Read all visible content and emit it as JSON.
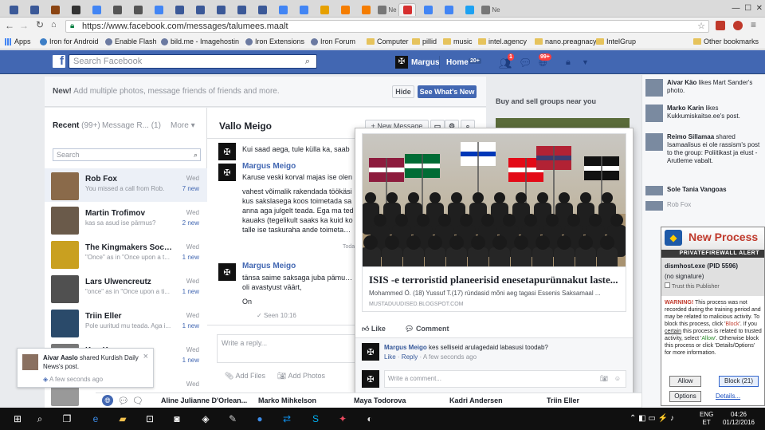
{
  "browser": {
    "tabs": [
      {
        "icon": "facebook-icon",
        "color": "#3b5998",
        "label": ""
      },
      {
        "icon": "blogger-b-icon",
        "color": "#3b5998",
        "label": ""
      },
      {
        "icon": "paw-icon",
        "color": "#8b4513",
        "label": ""
      },
      {
        "icon": "x-icon",
        "color": "#333333",
        "label": ""
      },
      {
        "icon": "google-g-icon",
        "color": "#4285f4",
        "label": ""
      },
      {
        "icon": "circle-icon",
        "color": "#555555",
        "label": ""
      },
      {
        "icon": "circle-icon",
        "color": "#555555",
        "label": ""
      },
      {
        "icon": "google-g-icon",
        "color": "#4285f4",
        "label": ""
      },
      {
        "icon": "facebook-icon",
        "color": "#3b5998",
        "label": ""
      },
      {
        "icon": "facebook-icon",
        "color": "#3b5998",
        "label": ""
      },
      {
        "icon": "facebook-icon",
        "color": "#3b5998",
        "label": ""
      },
      {
        "icon": "facebook-icon",
        "color": "#3b5998",
        "label": ""
      },
      {
        "icon": "facebook-icon",
        "color": "#3b5998",
        "label": ""
      },
      {
        "icon": "google-g-icon",
        "color": "#4285f4",
        "label": ""
      },
      {
        "icon": "google-g-icon",
        "color": "#4285f4",
        "label": ""
      },
      {
        "icon": "w-icon",
        "color": "#e6a000",
        "label": ""
      },
      {
        "icon": "blogger-icon",
        "color": "#f57d00",
        "label": ""
      },
      {
        "icon": "blogger-icon",
        "color": "#f57d00",
        "label": ""
      },
      {
        "icon": "news-icon",
        "color": "#777777",
        "label": "Ne"
      },
      {
        "icon": "close-x-icon",
        "color": "#d62f2f",
        "label": ""
      },
      {
        "icon": "google-g-icon",
        "color": "#4285f4",
        "label": ""
      },
      {
        "icon": "google-g-icon",
        "color": "#4285f4",
        "label": ""
      },
      {
        "icon": "twitter-icon",
        "color": "#1da1f2",
        "label": ""
      },
      {
        "icon": "news-icon",
        "color": "#777777",
        "label": "Ne"
      }
    ],
    "url": "https://www.facebook.com/messages/talumees.maalt",
    "apps_label": "Apps",
    "bookmarks": [
      {
        "label": "Iron for Android",
        "icon": "android-icon"
      },
      {
        "label": "Enable Flash",
        "icon": "page-icon"
      },
      {
        "label": "bild.me - Imagehostin",
        "icon": "page-icon"
      },
      {
        "label": "Iron Extensions",
        "icon": "page-icon"
      },
      {
        "label": "Iron Forum",
        "icon": "iron-icon"
      },
      {
        "label": "Computer",
        "icon": "folder-icon"
      },
      {
        "label": "pillid",
        "icon": "folder-icon"
      },
      {
        "label": "music",
        "icon": "folder-icon"
      },
      {
        "label": "intel.agency",
        "icon": "folder-icon"
      },
      {
        "label": "nano.preagnacy",
        "icon": "folder-icon"
      },
      {
        "label": "IntelGrup",
        "icon": "folder-icon"
      }
    ],
    "other_bookmarks": "Other bookmarks"
  },
  "fb_header": {
    "search_placeholder": "Search Facebook",
    "user": "Margus",
    "home": "Home",
    "home_badge": "20+",
    "friend_badge": "1",
    "notif_badge": "99+"
  },
  "messages": {
    "new_banner": {
      "bold": "New!",
      "text": "Add multiple photos, message friends of friends and more.",
      "hide": "Hide",
      "see_whats_new": "See What's New"
    },
    "tabs": {
      "recent": "Recent",
      "recent_count": "(99+)",
      "requests": "Message R...",
      "requests_count": "(1)",
      "more": "More"
    },
    "search_placeholder": "Search",
    "conversations": [
      {
        "name": "Rob Fox",
        "snippet": "You missed a call from Rob.",
        "date": "Wed",
        "new": "7 new",
        "color": "#8a6a4a"
      },
      {
        "name": "Martin Trofimov",
        "snippet": "kas sa asud ise pärmus?",
        "date": "Wed",
        "new": "2 new",
        "color": "#6a5a4a"
      },
      {
        "name": "The Kingmakers Society",
        "snippet": "\"Once\" as in \"Once upon a t...",
        "date": "Wed",
        "new": "1 new",
        "color": "#c9a020"
      },
      {
        "name": "Lars Ulwencreutz",
        "snippet": "\"once\" as in \"Once upon a ti...",
        "date": "Wed",
        "new": "1 new",
        "color": "#505050"
      },
      {
        "name": "Triin Eller",
        "snippet": "Pole uuritud mu teada. Aga i...",
        "date": "Wed",
        "new": "1 new",
        "color": "#2a4a6a"
      },
      {
        "name": "Ken K...",
        "snippet": "",
        "date": "Wed",
        "new": "1 new",
        "color": "#777777"
      },
      {
        "name": "",
        "snippet": "",
        "date": "Wed",
        "new": "",
        "color": "#999999"
      }
    ],
    "conversation_title": "Vallo Meigo",
    "new_message": "+ New Message",
    "thread": {
      "first_line": "Kui saad aega, tule külla ka, saab",
      "m1_sender": "Margus Meigo",
      "m1_line1": "Karuse veski korval majas ise olen",
      "m1_p2": [
        "vahest võimalik rakendada töökäsi",
        "kus sakslasega koos toimetada sa",
        "anna aga julgelt teada. Ega ma ted",
        "kauaks (tegelikult saaks ka kuid ko",
        "talle ise taskuraha ande toimetamis"
      ],
      "today": "Today",
      "m2_sender": "Margus Meigo",
      "m2_lines": [
        "tänsa saime saksaga juba pämut ja",
        "oli avastyust väärt,"
      ],
      "m2_last": "On",
      "seen": "Seen 10:16"
    },
    "reply_placeholder": "Write a reply...",
    "add_files": "Add Files",
    "add_photos": "Add Photos"
  },
  "right": {
    "groups_header": "Buy and sell groups near you"
  },
  "ticker": [
    {
      "bold": "Aivar Käo",
      "text": " likes Mart Sander's photo."
    },
    {
      "bold": "Marko Karin",
      "text": " likes Kukkumiskaitse.ee's post."
    },
    {
      "bold": "Reimo Sillamaa",
      "text": " shared Isamaalisus ei ole rassism's post to the group: Poliitikast ja elust - Arutleme vabalt."
    },
    {
      "bold": "Sole Tania Vangoas",
      "text": ""
    },
    {
      "bold": "Rob Fox",
      "text": ""
    }
  ],
  "popup": {
    "headline": "ISIS -e terroristid planeerisid enesetapurünnakut laste...",
    "desc": "Mohammed Ö. (18) Yussuf T.(17) ründasid mõni aeg tagasi Essenis Saksamaal ...",
    "domain": "MUSTADUUDISED.BLOGSPOT.COM",
    "like": "Like",
    "comment": "Comment",
    "comment_author": "Margus Meigo",
    "comment_text": " kes selliseid arulagedaid labasusi toodab?",
    "comment_like": "Like",
    "comment_reply": "Reply",
    "comment_time": "A few seconds ago",
    "write_comment": "Write a comment...",
    "flags": [
      {
        "name": "qatar-flag",
        "colors": [
          "#8d1b3d",
          "#ffffff"
        ]
      },
      {
        "name": "saudi-flag",
        "colors": [
          "#006c35",
          "#ffffff"
        ]
      },
      {
        "name": "israel-flag",
        "colors": [
          "#ffffff",
          "#0038b8"
        ]
      },
      {
        "name": "turkey-flag",
        "colors": [
          "#e30a17",
          "#ffffff"
        ]
      },
      {
        "name": "usa-flag",
        "colors": [
          "#b22234",
          "#3c3b6e"
        ]
      },
      {
        "name": "black-flag",
        "colors": [
          "#111111",
          "#ffffff"
        ]
      }
    ]
  },
  "notification": {
    "bold": "Aivar Aaslo",
    "text": " shared Kurdish Daily News's post.",
    "time": "A few seconds ago"
  },
  "chat_tabs": [
    "Aline Julianne D'Orlean...",
    "Marko Mihkelson",
    "Maya Todorova",
    "Kadri Andersen",
    "Triin Eller"
  ],
  "firewall": {
    "title": "New Process",
    "subtitle": "PRIVATEFIREWALL ALERT",
    "process": "dismhost.exe (PID 5596)",
    "signature": "(no signature)",
    "trust": "Trust this Publisher",
    "warning_label": "WARNING!",
    "warning_pre": " This process was not recorded during the training period and may be related to malicious activity. To block this process, click '",
    "block_word": "Block",
    "warning_mid": "'. If you ",
    "certain_word": "certain",
    "warning_mid2": " this process is related to trusted activity, select '",
    "allow_word": "Allow",
    "warning_post": "'. Otherwise block this process or click 'Details/Options' for more information.",
    "allow_btn": "Allow",
    "block_btn": "Block (21)",
    "options_btn": "Options",
    "details_link": "Details..."
  },
  "taskbar": {
    "lang1": "ENG",
    "lang2": "ET",
    "time": "04:26",
    "date": "01/12/2016"
  }
}
